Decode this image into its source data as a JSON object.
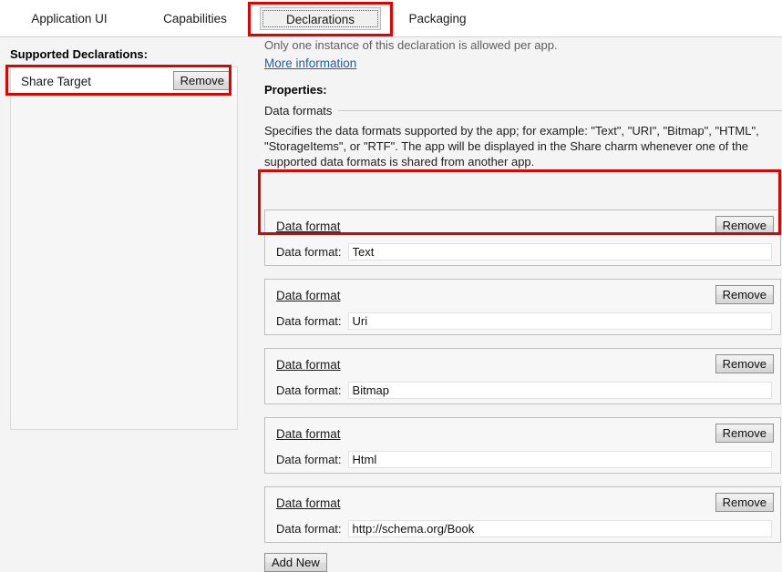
{
  "tabs": [
    {
      "label": "Application UI",
      "selected": false
    },
    {
      "label": "Capabilities",
      "selected": false
    },
    {
      "label": "Declarations",
      "selected": true
    },
    {
      "label": "Packaging",
      "selected": false
    }
  ],
  "left_pane": {
    "heading": "Supported Declarations:",
    "items": [
      {
        "label": "Share Target",
        "remove_label": "Remove"
      }
    ]
  },
  "right_pane": {
    "note": "Only one instance of this declaration is allowed per app.",
    "more_information_link": "More information",
    "properties_title": "Properties:",
    "section_heading": "Data formats",
    "description": "Specifies the data formats supported by the app; for example: \"Text\", \"URI\", \"Bitmap\", \"HTML\", \"StorageItems\", or \"RTF\". The app will be displayed in the Share charm whenever one of the supported data formats is shared from another app.",
    "add_new_label": "Add New",
    "groups": [
      {
        "header": "Data format",
        "remove_label": "Remove",
        "field_label": "Data format:",
        "value": "Text"
      },
      {
        "header": "Data format",
        "remove_label": "Remove",
        "field_label": "Data format:",
        "value": "Uri"
      },
      {
        "header": "Data format",
        "remove_label": "Remove",
        "field_label": "Data format:",
        "value": "Bitmap"
      },
      {
        "header": "Data format",
        "remove_label": "Remove",
        "field_label": "Data format:",
        "value": "Html"
      },
      {
        "header": "Data format",
        "remove_label": "Remove",
        "field_label": "Data format:",
        "value": "http://schema.org/Book"
      }
    ]
  },
  "annotations": {
    "color": "#e00000",
    "targets": [
      "declarations-tab",
      "share-target-row",
      "first-data-format-group"
    ]
  },
  "colors": {
    "background": "#f4f4f4",
    "tabstrip": "#ffffff",
    "link": "#1f5fa8",
    "note_text": "#5e5e5e",
    "annotation_red": "#e00000"
  }
}
